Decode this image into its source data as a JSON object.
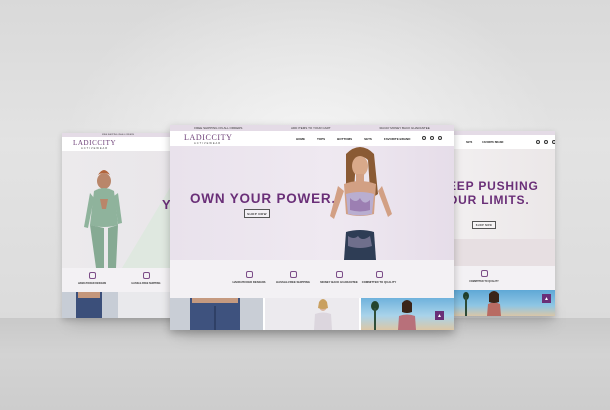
{
  "brand": {
    "logo": "LADICCITY",
    "tagline": "ACTIVEWEAR",
    "accent_color": "#6a2f78"
  },
  "topbar": {
    "left_text": "FREE SHIPPING ON ALL ORDERS",
    "center_text": "ADD ITEMS TO YOUR CART",
    "right_text": "30-DAY MONEY BACK GUARANTEE"
  },
  "nav": {
    "items": [
      "HOME",
      "TOPS",
      "BOTTOMS",
      "SETS",
      "FAVORITE BRAND"
    ],
    "icons": [
      "search-icon",
      "cart-icon",
      "user-icon"
    ]
  },
  "center_screen": {
    "hero_title": "OWN YOUR POWER.",
    "shop_button": "SHOP NOW",
    "features": [
      {
        "icon": "design-icon",
        "label": "HAND-PICKED DESIGNS"
      },
      {
        "icon": "shipping-icon",
        "label": "HASSLE-FREE SHIPPING"
      },
      {
        "icon": "guarantee-icon",
        "label": "MONEY BACK GUARANTEE"
      },
      {
        "icon": "quality-icon",
        "label": "COMMITTED TO QUALITY"
      }
    ]
  },
  "left_screen": {
    "hero_title_partial": "Y",
    "features": [
      {
        "label": "HAND-PICKED DESIGNS"
      },
      {
        "label": "HASSLE-FREE SHIPPING"
      }
    ]
  },
  "right_screen": {
    "hero_line1": "EEP PUSHING",
    "hero_line2": "OUR LIMITS.",
    "shop_button": "SHOP NOW",
    "features": [
      {
        "label": "COMMITTED TO QUALITY"
      }
    ],
    "scroll_top": "▲"
  }
}
